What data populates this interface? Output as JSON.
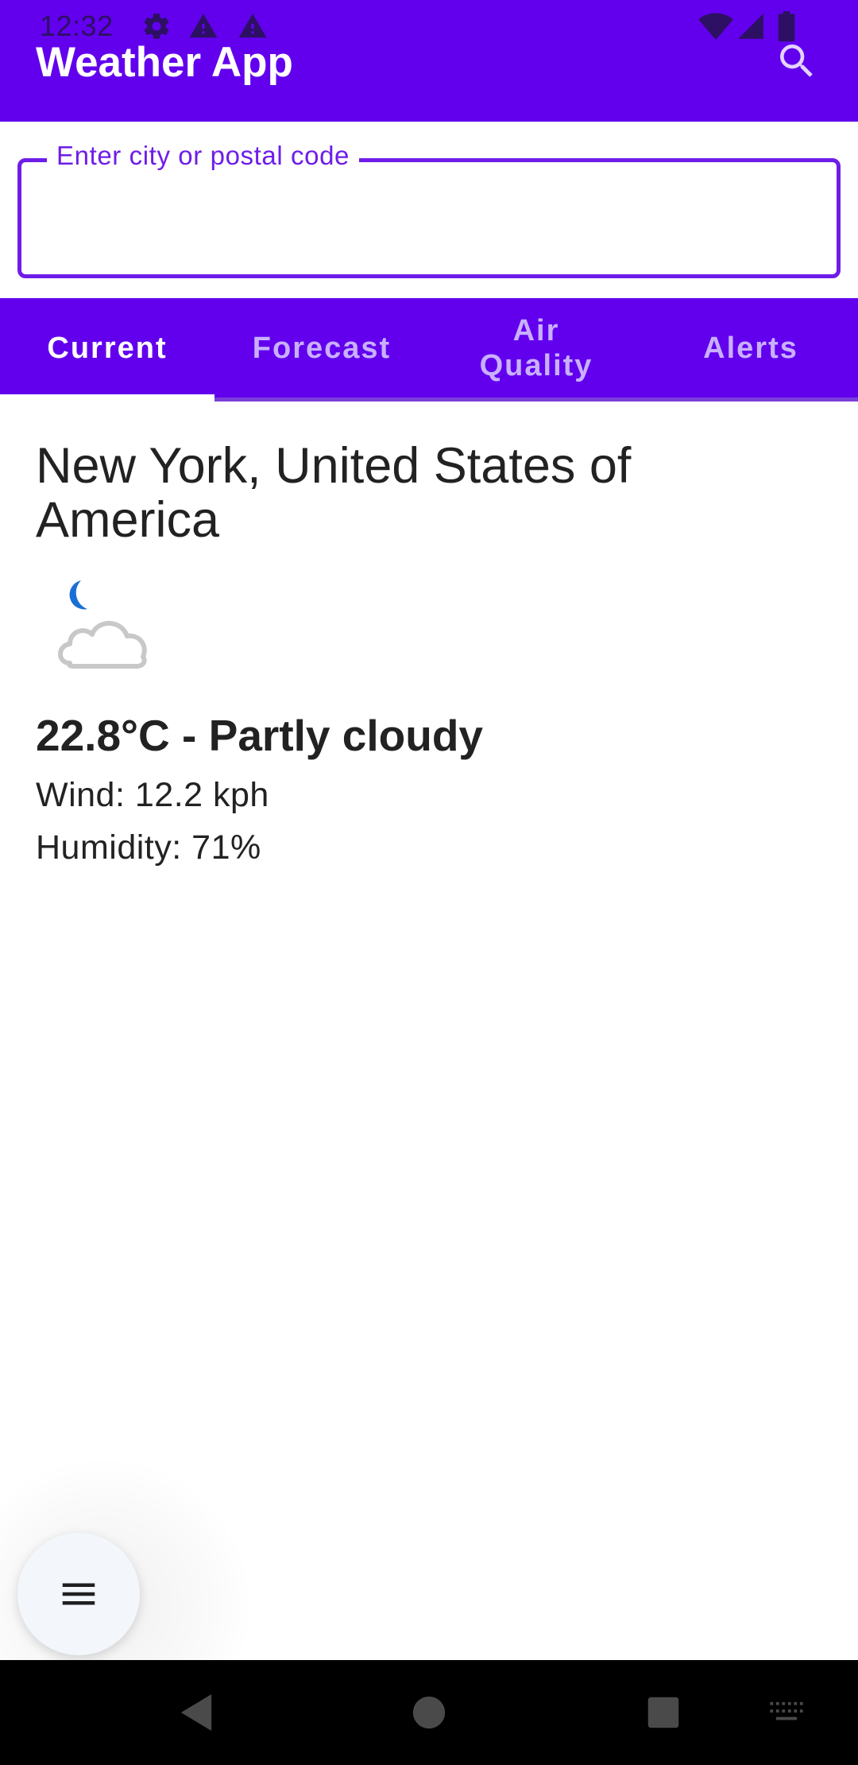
{
  "status_bar": {
    "time": "12:32"
  },
  "app_bar": {
    "title": "Weather App"
  },
  "search": {
    "label": "Enter city or postal code",
    "value": ""
  },
  "tabs": [
    {
      "label": "Current",
      "active": true
    },
    {
      "label": "Forecast",
      "active": false
    },
    {
      "label": "Air Quality",
      "active": false
    },
    {
      "label": "Alerts",
      "active": false
    }
  ],
  "current": {
    "location": "New York, United States of America",
    "icon": "partly-cloudy-night-icon",
    "temp_condition": "22.8°C - Partly cloudy",
    "wind": "Wind: 12.2 kph",
    "humidity": "Humidity: 71%"
  },
  "colors": {
    "primary": "#6200ee",
    "field_accent": "#6e1de8",
    "moon": "#1a6fd6"
  }
}
